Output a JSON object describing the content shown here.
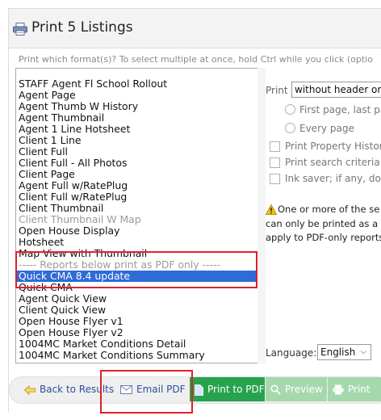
{
  "dialog": {
    "title": "Print 5 Listings",
    "instructions": "Print which format(s)? To select multiple at once, hold Ctrl while you click (optio"
  },
  "formats": [
    {
      "label": "STAFF Agent Fl School Rollout",
      "state": "normal"
    },
    {
      "label": "Agent Page",
      "state": "normal"
    },
    {
      "label": "Agent Thumb W History",
      "state": "normal"
    },
    {
      "label": "Agent Thumbnail",
      "state": "normal"
    },
    {
      "label": "Agent 1 Line Hotsheet",
      "state": "normal"
    },
    {
      "label": "Client 1 Line",
      "state": "normal"
    },
    {
      "label": "Client Full",
      "state": "normal"
    },
    {
      "label": "Client Full - All Photos",
      "state": "normal"
    },
    {
      "label": "Client Page",
      "state": "normal"
    },
    {
      "label": "Agent Full w/RatePlug",
      "state": "normal"
    },
    {
      "label": "Client Full w/RatePlug",
      "state": "normal"
    },
    {
      "label": "Client Thumbnail",
      "state": "normal"
    },
    {
      "label": "Client Thumbnail W Map",
      "state": "disabled"
    },
    {
      "label": "Open House Display",
      "state": "normal"
    },
    {
      "label": "Hotsheet",
      "state": "normal"
    },
    {
      "label": "Map View with Thumbnail",
      "state": "normal"
    },
    {
      "label": "----- Reports below print as PDF only -----",
      "state": "disabled"
    },
    {
      "label": "Quick CMA 8.4 update",
      "state": "selected"
    },
    {
      "label": "Quick CMA",
      "state": "normal"
    },
    {
      "label": "Agent Quick View",
      "state": "normal"
    },
    {
      "label": "Client Quick View",
      "state": "normal"
    },
    {
      "label": "Open House Flyer v1",
      "state": "normal"
    },
    {
      "label": "Open House Flyer v2",
      "state": "normal"
    },
    {
      "label": "1004MC Market Conditions Detail",
      "state": "normal"
    },
    {
      "label": "1004MC Market Conditions Summary",
      "state": "normal"
    }
  ],
  "options": {
    "print_label": "Print",
    "print_mode_value": "without header or fo",
    "radio_first_page": "First page, last pa",
    "radio_every_page": "Every page",
    "check_property_history": "Print Property History",
    "check_search_criteria": "Print search criteria",
    "check_ink_saver": "Ink saver; if any, do",
    "warning_line1": "One or more of the se",
    "warning_line2": "can only be printed as a",
    "warning_line3": "apply to PDF-only reports",
    "language_label": "Language:",
    "language_value": "English"
  },
  "footer": {
    "back_label": "Back to Results",
    "email_label": "Email PDF",
    "print_pdf_label": "Print to PDF",
    "preview_label": "Preview",
    "print_label": "Print"
  },
  "colors": {
    "selection": "#2f6bd6",
    "primary_button": "#27a34e",
    "disabled_button": "#a6d8ae",
    "highlight_box": "#e0202c"
  }
}
